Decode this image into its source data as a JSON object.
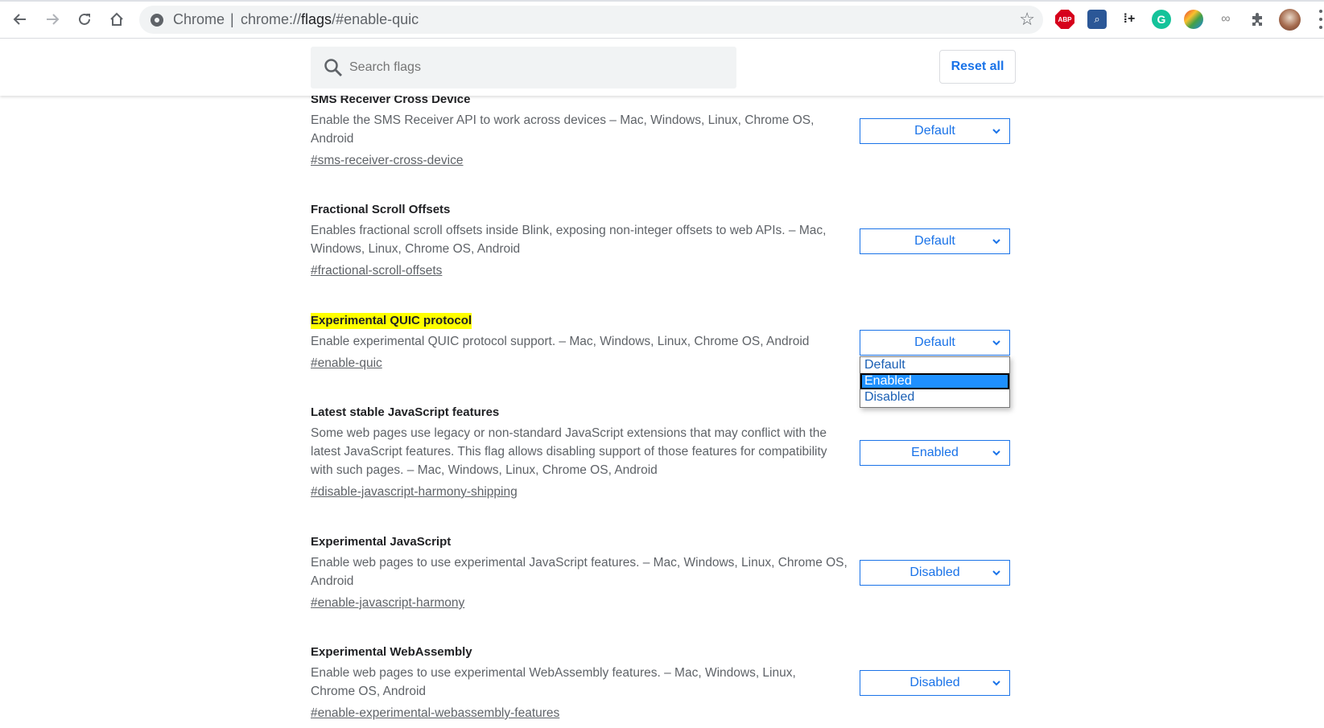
{
  "browser": {
    "site_label": "Chrome",
    "url_prefix": "chrome://",
    "url_host": "flags",
    "url_rest": "/#enable-quic",
    "extensions": [
      {
        "name": "adblock-plus",
        "label": "ABP"
      },
      {
        "name": "search-extension",
        "label": "⌕"
      },
      {
        "name": "grid-plus",
        "label": "⁞+"
      },
      {
        "name": "grammarly",
        "label": "G"
      },
      {
        "name": "internet-download-manager",
        "label": ""
      },
      {
        "name": "rings-extension",
        "label": "∞"
      },
      {
        "name": "extensions-puzzle",
        "label": "✱"
      }
    ]
  },
  "header": {
    "search_placeholder": "Search flags",
    "search_value": "",
    "reset_label": "Reset all"
  },
  "flags": [
    {
      "title": "SMS Receiver Cross Device",
      "description": "Enable the SMS Receiver API to work across devices – Mac, Windows, Linux, Chrome OS, Android",
      "link": "#sms-receiver-cross-device",
      "value": "Default",
      "highlighted": false
    },
    {
      "title": "Fractional Scroll Offsets",
      "description": "Enables fractional scroll offsets inside Blink, exposing non-integer offsets to web APIs. – Mac, Windows, Linux, Chrome OS, Android",
      "link": "#fractional-scroll-offsets",
      "value": "Default",
      "highlighted": false
    },
    {
      "title": "Experimental QUIC protocol",
      "description": "Enable experimental QUIC protocol support. – Mac, Windows, Linux, Chrome OS, Android",
      "link": "#enable-quic",
      "value": "Default",
      "highlighted": true
    },
    {
      "title": "Latest stable JavaScript features",
      "description": "Some web pages use legacy or non-standard JavaScript extensions that may conflict with the latest JavaScript features. This flag allows disabling support of those features for compatibility with such pages. – Mac, Windows, Linux, Chrome OS, Android",
      "link": "#disable-javascript-harmony-shipping",
      "value": "Enabled",
      "highlighted": false
    },
    {
      "title": "Experimental JavaScript",
      "description": "Enable web pages to use experimental JavaScript features. – Mac, Windows, Linux, Chrome OS, Android",
      "link": "#enable-javascript-harmony",
      "value": "Disabled",
      "highlighted": false
    },
    {
      "title": "Experimental WebAssembly",
      "description": "Enable web pages to use experimental WebAssembly features. – Mac, Windows, Linux, Chrome OS, Android",
      "link": "#enable-experimental-webassembly-features",
      "value": "Disabled",
      "highlighted": false
    }
  ],
  "open_dropdown": {
    "flag": "Experimental QUIC protocol",
    "options": [
      "Default",
      "Enabled",
      "Disabled"
    ],
    "highlighted_option": "Enabled"
  }
}
